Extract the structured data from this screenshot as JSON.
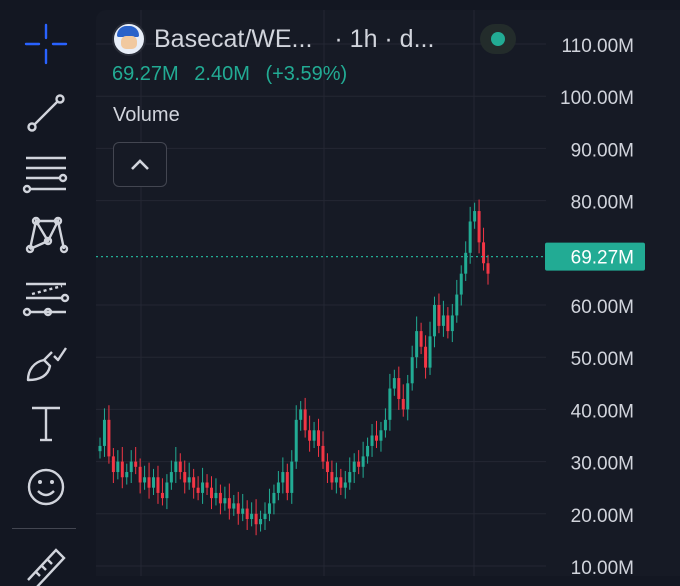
{
  "header": {
    "symbol": "Basecat/WE...",
    "meta": "· 1h · d...",
    "status_color": "#22ab94"
  },
  "quote": {
    "last": "69.27M",
    "change": "2.40M",
    "change_pct": "(+3.59%)"
  },
  "indicator": {
    "label": "Volume"
  },
  "price_label": "69.27M",
  "toolbar": {
    "tools": [
      "crosshair-icon",
      "trend-line-icon",
      "fib-retracement-icon",
      "xabcd-pattern-icon",
      "prediction-icon",
      "brush-icon",
      "text-icon",
      "emoji-icon",
      "ruler-icon"
    ]
  },
  "colors": {
    "up": "#22ab94",
    "down": "#f23645",
    "text": "#d1d4dc",
    "accent": "#2962ff"
  },
  "chart_data": {
    "type": "candlestick",
    "ylim": [
      10000000,
      110000000
    ],
    "y_ticks": [
      "110.00M",
      "100.00M",
      "90.00M",
      "80.00M",
      "69.27M",
      "60.00M",
      "50.00M",
      "40.00M",
      "30.00M",
      "20.00M",
      "10.00M"
    ],
    "last_price": 69270000,
    "close": [
      33,
      38,
      31,
      28,
      30,
      27,
      28,
      30,
      29,
      26,
      27,
      25,
      27,
      24,
      23,
      26,
      28,
      30,
      28,
      26,
      27,
      25,
      24,
      26,
      25,
      23,
      24,
      22,
      23,
      21,
      22,
      20,
      21,
      19,
      20,
      18,
      19,
      20,
      22,
      24,
      26,
      28,
      24,
      30,
      38,
      40,
      36,
      34,
      36,
      33,
      30,
      28,
      26,
      27,
      25,
      26,
      28,
      30,
      29,
      31,
      33,
      35,
      34,
      36,
      38,
      44,
      46,
      42,
      40,
      45,
      50,
      55,
      52,
      48,
      54,
      60,
      56,
      58,
      55,
      58,
      62,
      66,
      70,
      76,
      78,
      72,
      68,
      66
    ]
  }
}
